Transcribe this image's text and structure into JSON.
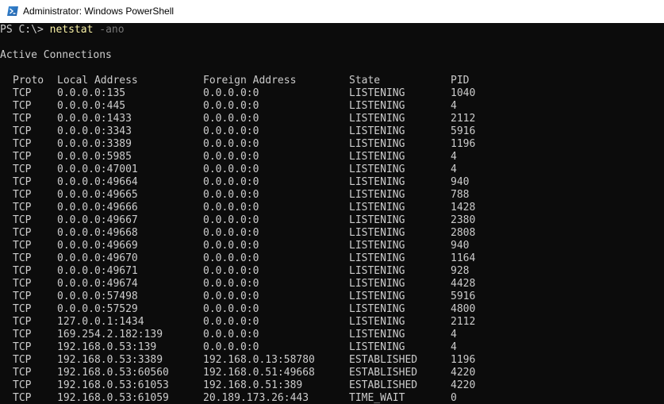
{
  "window": {
    "title": "Administrator: Windows PowerShell",
    "icon": "powershell-icon",
    "colors": {
      "titlebar_bg": "#ffffff",
      "console_bg": "#0c0c0c",
      "text": "#cccccc",
      "command": "#f9f1a5",
      "argument": "#767676"
    }
  },
  "console": {
    "prompt": "PS C:\\> ",
    "command": "netstat",
    "argument": " -ano",
    "heading": "Active Connections",
    "columns": {
      "proto": "Proto",
      "local": "Local Address",
      "foreign": "Foreign Address",
      "state": "State",
      "pid": "PID"
    },
    "rows": [
      {
        "proto": "TCP",
        "local": "0.0.0.0:135",
        "foreign": "0.0.0.0:0",
        "state": "LISTENING",
        "pid": "1040"
      },
      {
        "proto": "TCP",
        "local": "0.0.0.0:445",
        "foreign": "0.0.0.0:0",
        "state": "LISTENING",
        "pid": "4"
      },
      {
        "proto": "TCP",
        "local": "0.0.0.0:1433",
        "foreign": "0.0.0.0:0",
        "state": "LISTENING",
        "pid": "2112"
      },
      {
        "proto": "TCP",
        "local": "0.0.0.0:3343",
        "foreign": "0.0.0.0:0",
        "state": "LISTENING",
        "pid": "5916"
      },
      {
        "proto": "TCP",
        "local": "0.0.0.0:3389",
        "foreign": "0.0.0.0:0",
        "state": "LISTENING",
        "pid": "1196"
      },
      {
        "proto": "TCP",
        "local": "0.0.0.0:5985",
        "foreign": "0.0.0.0:0",
        "state": "LISTENING",
        "pid": "4"
      },
      {
        "proto": "TCP",
        "local": "0.0.0.0:47001",
        "foreign": "0.0.0.0:0",
        "state": "LISTENING",
        "pid": "4"
      },
      {
        "proto": "TCP",
        "local": "0.0.0.0:49664",
        "foreign": "0.0.0.0:0",
        "state": "LISTENING",
        "pid": "940"
      },
      {
        "proto": "TCP",
        "local": "0.0.0.0:49665",
        "foreign": "0.0.0.0:0",
        "state": "LISTENING",
        "pid": "788"
      },
      {
        "proto": "TCP",
        "local": "0.0.0.0:49666",
        "foreign": "0.0.0.0:0",
        "state": "LISTENING",
        "pid": "1428"
      },
      {
        "proto": "TCP",
        "local": "0.0.0.0:49667",
        "foreign": "0.0.0.0:0",
        "state": "LISTENING",
        "pid": "2380"
      },
      {
        "proto": "TCP",
        "local": "0.0.0.0:49668",
        "foreign": "0.0.0.0:0",
        "state": "LISTENING",
        "pid": "2808"
      },
      {
        "proto": "TCP",
        "local": "0.0.0.0:49669",
        "foreign": "0.0.0.0:0",
        "state": "LISTENING",
        "pid": "940"
      },
      {
        "proto": "TCP",
        "local": "0.0.0.0:49670",
        "foreign": "0.0.0.0:0",
        "state": "LISTENING",
        "pid": "1164"
      },
      {
        "proto": "TCP",
        "local": "0.0.0.0:49671",
        "foreign": "0.0.0.0:0",
        "state": "LISTENING",
        "pid": "928"
      },
      {
        "proto": "TCP",
        "local": "0.0.0.0:49674",
        "foreign": "0.0.0.0:0",
        "state": "LISTENING",
        "pid": "4428"
      },
      {
        "proto": "TCP",
        "local": "0.0.0.0:57498",
        "foreign": "0.0.0.0:0",
        "state": "LISTENING",
        "pid": "5916"
      },
      {
        "proto": "TCP",
        "local": "0.0.0.0:57529",
        "foreign": "0.0.0.0:0",
        "state": "LISTENING",
        "pid": "4800"
      },
      {
        "proto": "TCP",
        "local": "127.0.0.1:1434",
        "foreign": "0.0.0.0:0",
        "state": "LISTENING",
        "pid": "2112"
      },
      {
        "proto": "TCP",
        "local": "169.254.2.182:139",
        "foreign": "0.0.0.0:0",
        "state": "LISTENING",
        "pid": "4"
      },
      {
        "proto": "TCP",
        "local": "192.168.0.53:139",
        "foreign": "0.0.0.0:0",
        "state": "LISTENING",
        "pid": "4"
      },
      {
        "proto": "TCP",
        "local": "192.168.0.53:3389",
        "foreign": "192.168.0.13:58780",
        "state": "ESTABLISHED",
        "pid": "1196"
      },
      {
        "proto": "TCP",
        "local": "192.168.0.53:60560",
        "foreign": "192.168.0.51:49668",
        "state": "ESTABLISHED",
        "pid": "4220"
      },
      {
        "proto": "TCP",
        "local": "192.168.0.53:61053",
        "foreign": "192.168.0.51:389",
        "state": "ESTABLISHED",
        "pid": "4220"
      },
      {
        "proto": "TCP",
        "local": "192.168.0.53:61059",
        "foreign": "20.189.173.26:443",
        "state": "TIME_WAIT",
        "pid": "0"
      }
    ]
  }
}
